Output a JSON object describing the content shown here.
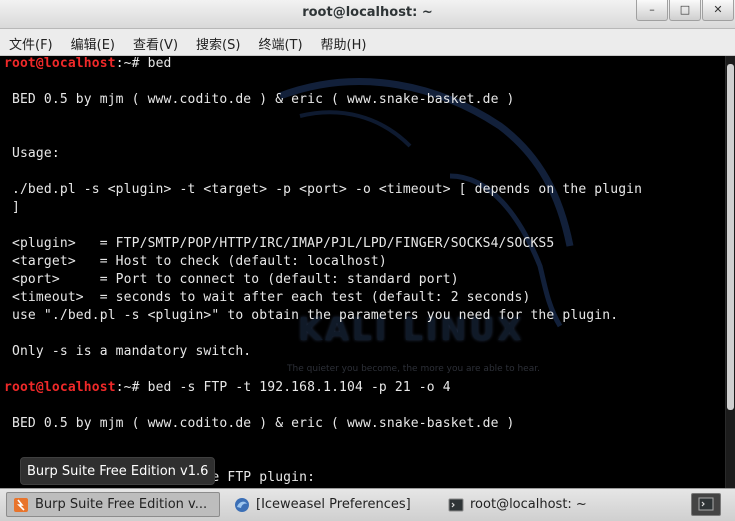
{
  "window": {
    "title": "root@localhost: ~",
    "buttons": [
      "–",
      "□",
      "✕"
    ]
  },
  "menu": [
    {
      "label": "文件(F)"
    },
    {
      "label": "编辑(E)"
    },
    {
      "label": "查看(V)"
    },
    {
      "label": "搜索(S)"
    },
    {
      "label": "终端(T)"
    },
    {
      "label": "帮助(H)"
    }
  ],
  "prompt": {
    "user": "root@localhost",
    "path": ":~#"
  },
  "terminal": {
    "cmd1": " bed",
    "l_banner1": " BED 0.5 by mjm ( www.codito.de ) & eric ( www.snake-basket.de )",
    "l_usage": " Usage:",
    "l_syntax": " ./bed.pl -s <plugin> -t <target> -p <port> -o <timeout> [ depends on the plugin",
    "l_bracket": " ]",
    "l_plugin": " <plugin>   = FTP/SMTP/POP/HTTP/IRC/IMAP/PJL/LPD/FINGER/SOCKS4/SOCKS5",
    "l_target": " <target>   = Host to check (default: localhost)",
    "l_port": " <port>     = Port to connect to (default: standard port)",
    "l_timeout": " <timeout>  = seconds to wait after each test (default: 2 seconds)",
    "l_use": " use \"./bed.pl -s <plugin>\" to obtain the parameters you need for the plugin.",
    "l_only": " Only -s is a mandatory switch.",
    "cmd2": " bed -s FTP -t 192.168.1.104 -p 21 -o 4",
    "l_banner2": " BED 0.5 by mjm ( www.codito.de ) & eric ( www.snake-basket.de )",
    "l_partial": "                         he FTP plugin:"
  },
  "watermark": {
    "logo": "KALI LINUX",
    "motto": "The quieter you become, the more you are able to hear."
  },
  "tooltip": {
    "text": "Burp Suite Free Edition v1.6"
  },
  "taskbar": {
    "items": [
      {
        "label": "Burp Suite Free Edition v...",
        "icon": "burp-icon"
      },
      {
        "label": "[Iceweasel Preferences]",
        "icon": "iceweasel-icon"
      },
      {
        "label": "root@localhost: ~",
        "icon": "terminal-icon"
      }
    ]
  },
  "colors": {
    "prompt_user": "#ef2929",
    "prompt_path": "#729fcf",
    "text": "#e8e8e8",
    "background": "#000000"
  }
}
